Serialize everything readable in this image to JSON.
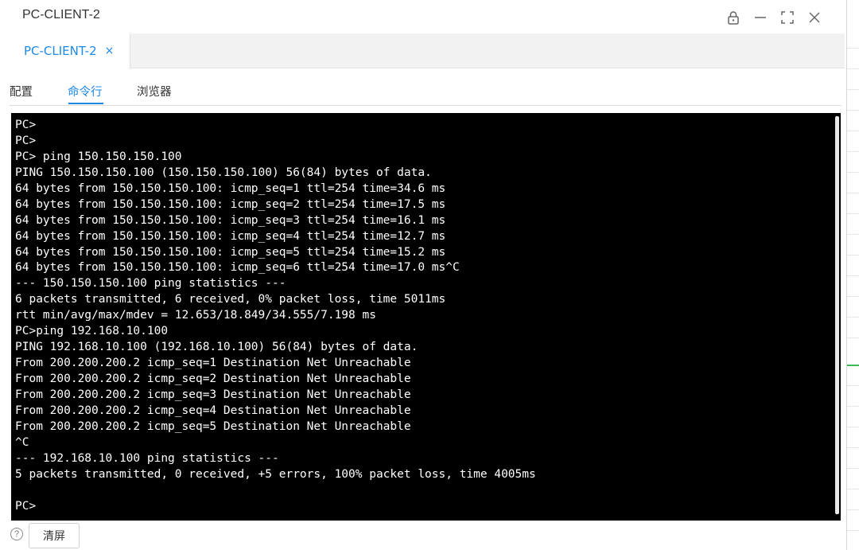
{
  "window": {
    "title": "PC-CLIENT-2"
  },
  "tabs": [
    {
      "label": "PC-CLIENT-2",
      "close": "×"
    }
  ],
  "subtabs": [
    {
      "label": "配置"
    },
    {
      "label": "命令行"
    },
    {
      "label": "浏览器"
    }
  ],
  "active_subtab": "命令行",
  "terminal": {
    "lines": [
      "PC>",
      "PC>",
      "PC> ping 150.150.150.100",
      "PING 150.150.150.100 (150.150.150.100) 56(84) bytes of data.",
      "64 bytes from 150.150.150.100: icmp_seq=1 ttl=254 time=34.6 ms",
      "64 bytes from 150.150.150.100: icmp_seq=2 ttl=254 time=17.5 ms",
      "64 bytes from 150.150.150.100: icmp_seq=3 ttl=254 time=16.1 ms",
      "64 bytes from 150.150.150.100: icmp_seq=4 ttl=254 time=12.7 ms",
      "64 bytes from 150.150.150.100: icmp_seq=5 ttl=254 time=15.2 ms",
      "64 bytes from 150.150.150.100: icmp_seq=6 ttl=254 time=17.0 ms^C",
      "--- 150.150.150.100 ping statistics ---",
      "6 packets transmitted, 6 received, 0% packet loss, time 5011ms",
      "rtt min/avg/max/mdev = 12.653/18.849/34.555/7.198 ms",
      "PC>ping 192.168.10.100",
      "PING 192.168.10.100 (192.168.10.100) 56(84) bytes of data.",
      "From 200.200.200.2 icmp_seq=1 Destination Net Unreachable",
      "From 200.200.200.2 icmp_seq=2 Destination Net Unreachable",
      "From 200.200.200.2 icmp_seq=3 Destination Net Unreachable",
      "From 200.200.200.2 icmp_seq=4 Destination Net Unreachable",
      "From 200.200.200.2 icmp_seq=5 Destination Net Unreachable",
      "^C",
      "--- 192.168.10.100 ping statistics ---",
      "5 packets transmitted, 0 received, +5 errors, 100% packet loss, time 4005ms",
      "",
      "PC>"
    ]
  },
  "bottom": {
    "help_glyph": "?",
    "clear_label": "清屏"
  },
  "colors": {
    "accent": "#1e88e5",
    "terminal_bg": "#000000",
    "terminal_fg": "#ffffff"
  },
  "icons": [
    "lock-icon",
    "minimize-icon",
    "maximize-icon",
    "close-icon",
    "help-icon"
  ]
}
